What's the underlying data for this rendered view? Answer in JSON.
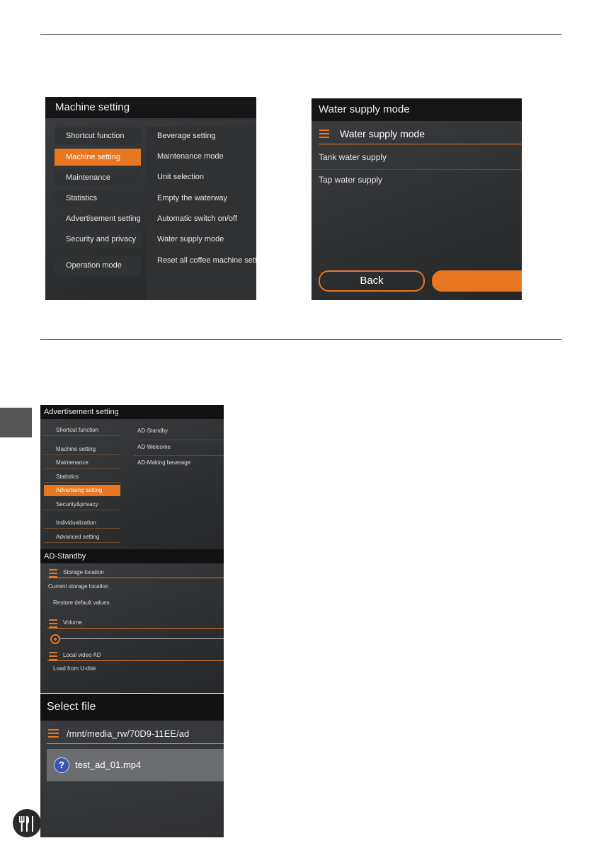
{
  "screen1": {
    "title": "Machine setting",
    "left_menu": [
      "Shortcut function",
      "Machine setting",
      "Maintenance",
      "Statistics",
      "Advertisement setting",
      "Security and privacy",
      "Operation mode"
    ],
    "active_left": "Machine setting",
    "right_menu": [
      "Beverage setting",
      "Maintenance mode",
      "Unit selection",
      "Empty the waterway",
      "Automatic switch on/off",
      "Water supply mode",
      "Reset all coffee machine setting"
    ]
  },
  "screen2": {
    "title": "Water supply mode",
    "header": "Water supply mode",
    "options": [
      "Tank water supply",
      "Tap water supply"
    ],
    "back_label": "Back",
    "accent": "#e87722"
  },
  "screen3": {
    "title": "Advertisement setting",
    "left_menu": [
      "Shortcut function",
      "Machine setting",
      "Maintenance",
      "Statistics",
      "Advertising setting",
      "Security&privacy",
      "Individualization",
      "Advanced setting"
    ],
    "active_left": "Advertising setting",
    "right_menu": [
      "AD-Standby",
      "AD-Welcome",
      "AD-Making beverage"
    ]
  },
  "screen4": {
    "title": "AD-Standby",
    "storage_header": "Storage location",
    "current_storage": "Current storage location",
    "restore_defaults": "Restore default values",
    "volume_header": "Volume",
    "volume_level": 0,
    "local_video_header": "Local video AD",
    "load_from_udisk": "Load from U-disk"
  },
  "screen5": {
    "title": "Select file",
    "path": "/mnt/media_rw/70D9-11EE/ad",
    "file": "test_ad_01.mp4",
    "file_icon": "question-icon"
  }
}
